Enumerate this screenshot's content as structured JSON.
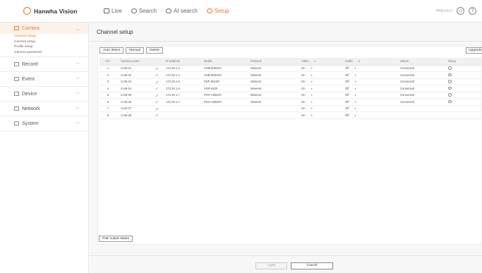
{
  "brand": {
    "name": "Hanwha Vision"
  },
  "nav": [
    {
      "label": "Live",
      "icon": "monitor-icon",
      "active": false
    },
    {
      "label": "Search",
      "icon": "search-icon",
      "active": false
    },
    {
      "label": "AI search",
      "icon": "ai-search-icon",
      "active": false
    },
    {
      "label": "Setup",
      "icon": "gear-icon",
      "active": true
    }
  ],
  "topright": {
    "model": "PRN-6410",
    "icons": [
      "user-icon",
      "help-icon"
    ]
  },
  "sidebar": {
    "groups": [
      {
        "label": "Camera",
        "icon": "camera-icon",
        "active": true,
        "items": [
          "Channel setup",
          "Camera setup",
          "Profile setup",
          "Camera password"
        ]
      },
      {
        "label": "Record",
        "icon": "record-icon",
        "active": false,
        "items": []
      },
      {
        "label": "Event",
        "icon": "event-icon",
        "active": false,
        "items": []
      },
      {
        "label": "Device",
        "icon": "device-icon",
        "active": false,
        "items": []
      },
      {
        "label": "Network",
        "icon": "network-icon",
        "active": false,
        "items": []
      },
      {
        "label": "System",
        "icon": "system-icon",
        "active": false,
        "items": []
      }
    ]
  },
  "page": {
    "title": "Channel setup"
  },
  "toolbar": {
    "auto_detect": "Auto detect",
    "manual": "Manual",
    "delete": "Delete",
    "upgrade": "Upgrade"
  },
  "table": {
    "headers": [
      "CH.",
      "Camera name",
      "",
      "IP address",
      "Model",
      "Protocol",
      "Video",
      "Audio",
      "Status",
      "Setup"
    ],
    "rows": [
      {
        "ch": "1",
        "name": "CAM 01",
        "ip": "172.30.1.3",
        "model": "XNB-6081R2",
        "protocol": "Wisenet",
        "video": "On",
        "audio": "Off",
        "status": "Connected"
      },
      {
        "ch": "2",
        "name": "CAM 02",
        "ip": "172.30.1.4",
        "model": "XNB-8081R2",
        "protocol": "Wisenet",
        "video": "On",
        "audio": "Off",
        "status": "Connected"
      },
      {
        "ch": "3",
        "name": "CAM 03",
        "ip": "172.30.1.5",
        "model": "PNF-8010R",
        "protocol": "Wisenet",
        "video": "On",
        "audio": "Off",
        "status": "Connected"
      },
      {
        "ch": "4",
        "name": "CAM 04",
        "ip": "172.30.1.6",
        "model": "XNP-6320",
        "protocol": "Wisenet",
        "video": "On",
        "audio": "Off",
        "status": "Connected"
      },
      {
        "ch": "5",
        "name": "CAM 05",
        "ip": "172.30.1.7",
        "model": "PNV-A6081R",
        "protocol": "Wisenet",
        "video": "On",
        "audio": "Off",
        "status": "Connected"
      },
      {
        "ch": "6",
        "name": "CAM 06",
        "ip": "172.30.1.7",
        "model": "PNV-A6081R",
        "protocol": "Wisenet",
        "video": "On",
        "audio": "Off",
        "status": "Connected"
      },
      {
        "ch": "7",
        "name": "CAM 07",
        "ip": "",
        "model": "",
        "protocol": "",
        "video": "On",
        "audio": "Off",
        "status": ""
      },
      {
        "ch": "8",
        "name": "CAM 08",
        "ip": "",
        "model": "",
        "protocol": "",
        "video": "On",
        "audio": "Off",
        "status": ""
      }
    ]
  },
  "footer": {
    "poe": "PoE output status",
    "apply": "Apply",
    "cancel": "Cancel"
  }
}
